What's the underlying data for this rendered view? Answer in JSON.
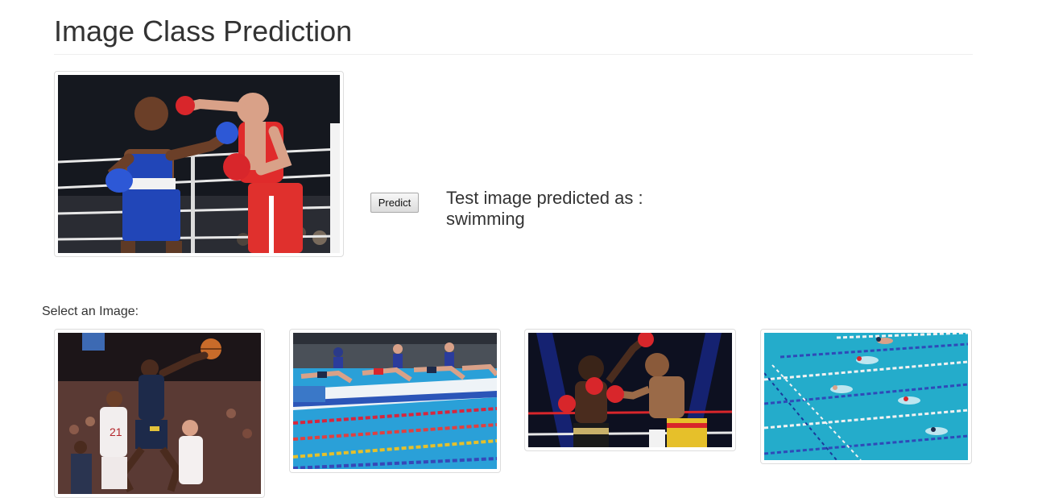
{
  "page": {
    "title": "Image Class Prediction"
  },
  "test": {
    "image_alt": "Two boxers in blue and red fighting in a ring",
    "predict_label": "Predict",
    "result_prefix": "Test image predicted as :",
    "result_class": "swimming"
  },
  "gallery": {
    "label": "Select an Image:",
    "images": [
      {
        "alt": "Basketball player going up for a layup",
        "class": "basketball"
      },
      {
        "alt": "Swimmers diving off starting blocks",
        "class": "swimming"
      },
      {
        "alt": "Two boxers exchanging punches",
        "class": "boxing"
      },
      {
        "alt": "Swimmers racing in a pool",
        "class": "swimming"
      }
    ]
  },
  "colors": {
    "text": "#333333",
    "border": "#dddddd",
    "rule": "#eeeeee"
  }
}
